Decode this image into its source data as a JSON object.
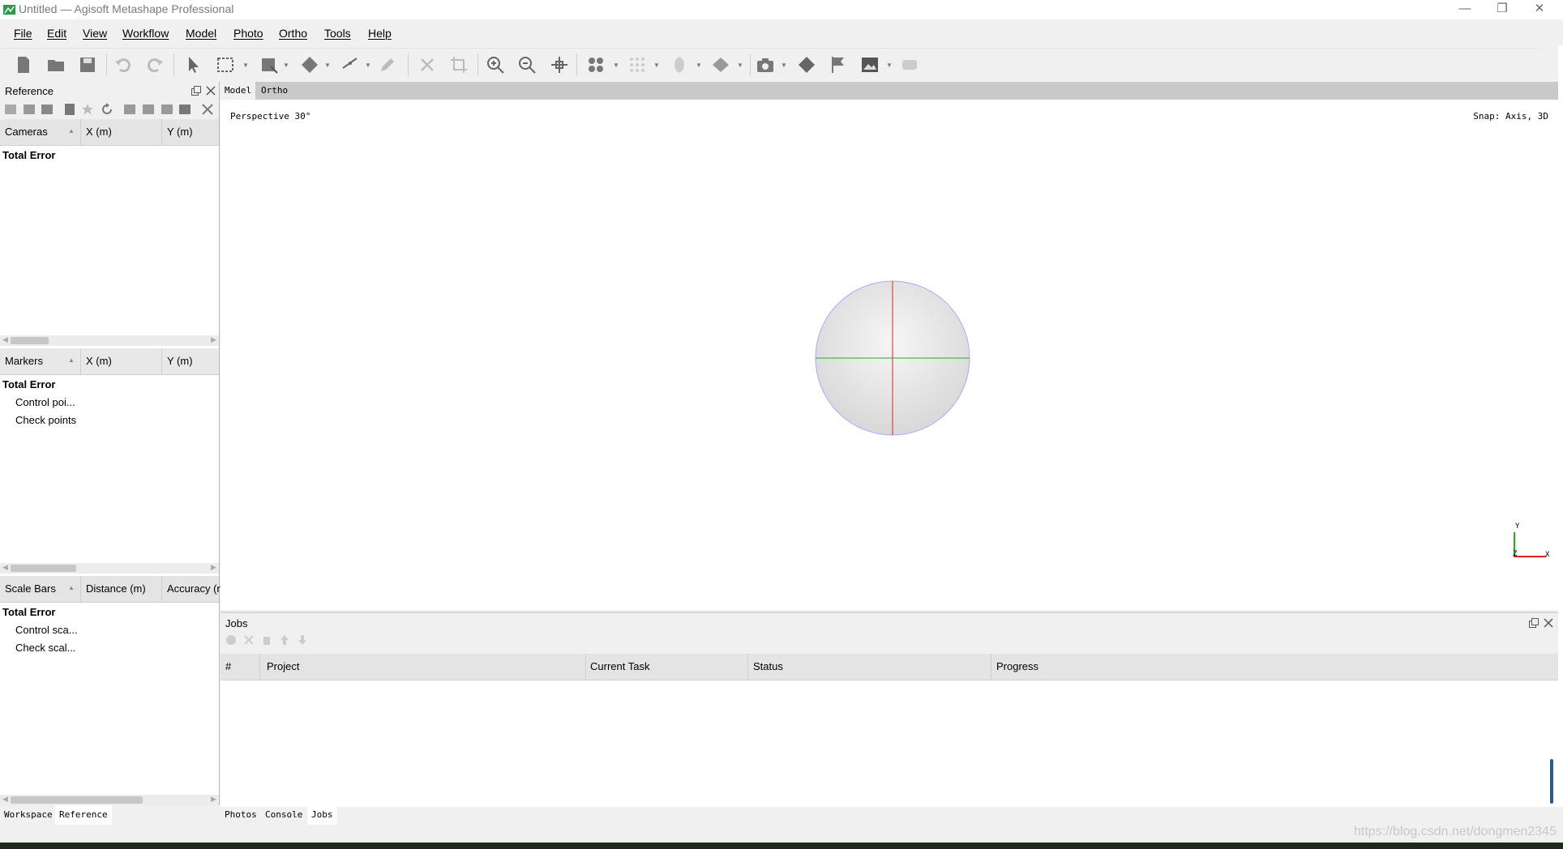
{
  "window": {
    "title": "Untitled — Agisoft Metashape Professional"
  },
  "menu": [
    "File",
    "Edit",
    "View",
    "Workflow",
    "Model",
    "Photo",
    "Ortho",
    "Tools",
    "Help"
  ],
  "reference_panel": {
    "title": "Reference",
    "cameras": {
      "headers": [
        "Cameras",
        "X (m)",
        "Y (m)"
      ],
      "rows": [
        "Total Error"
      ]
    },
    "markers": {
      "headers": [
        "Markers",
        "X (m)",
        "Y (m)"
      ],
      "rows": [
        "Total Error",
        "Control poi...",
        "Check points"
      ]
    },
    "scalebars": {
      "headers": [
        "Scale Bars",
        "Distance (m)",
        "Accuracy (r"
      ],
      "rows": [
        "Total Error",
        "Control sca...",
        "Check scal..."
      ]
    }
  },
  "left_tabs": [
    "Workspace",
    "Reference"
  ],
  "view_tabs": [
    "Model",
    "Ortho"
  ],
  "viewport": {
    "perspective": "Perspective 30°",
    "snap": "Snap: Axis, 3D",
    "axis_y": "Y",
    "axis_x": "X",
    "axis_z": "Z"
  },
  "jobs": {
    "title": "Jobs",
    "headers": [
      "#",
      "Project",
      "Current Task",
      "Status",
      "Progress"
    ]
  },
  "bottom_tabs": [
    "Photos",
    "Console",
    "Jobs"
  ],
  "watermark": "https://blog.csdn.net/dongmen2345",
  "colors": {
    "axis_red": "#e02020",
    "axis_green": "#20b020",
    "sphere_outline": "#a9a9ff"
  }
}
